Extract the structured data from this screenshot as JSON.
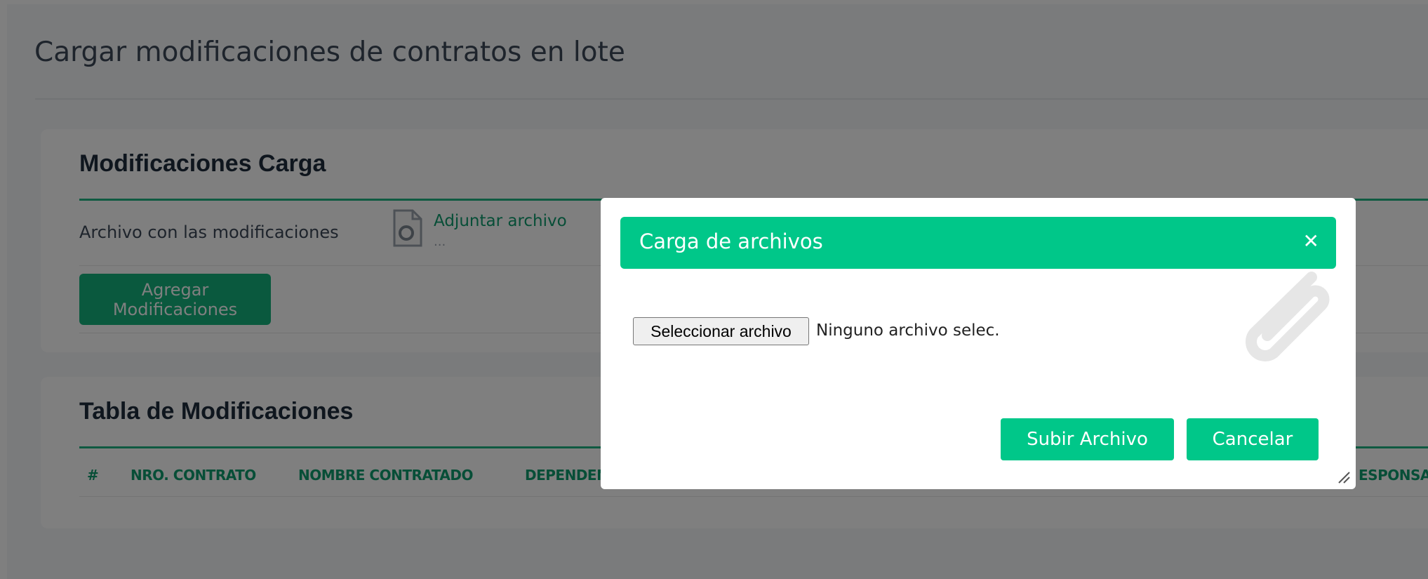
{
  "page": {
    "title": "Cargar modificaciones de contratos en lote"
  },
  "load_card": {
    "title": "Modificaciones Carga",
    "file_label": "Archivo con las modificaciones",
    "attach_link": "Adjuntar archivo",
    "attach_sub": "...",
    "add_button": "Agregar Modificaciones"
  },
  "table_card": {
    "title": "Tabla de Modificaciones",
    "columns": [
      "#",
      "NRO. CONTRATO",
      "NOMBRE CONTRATADO",
      "DEPENDEN",
      "ESPONSA"
    ]
  },
  "modal": {
    "title": "Carga de archivos",
    "close_icon": "close-icon",
    "file_button": "Seleccionar archivo",
    "file_status": "Ninguno archivo selec.",
    "upload_button": "Subir Archivo",
    "cancel_button": "Cancelar"
  },
  "colors": {
    "accent": "#00c789",
    "accent_dark": "#14b37d",
    "heading": "#1f2d3d",
    "overlay": "rgba(0,0,0,0.5)"
  }
}
